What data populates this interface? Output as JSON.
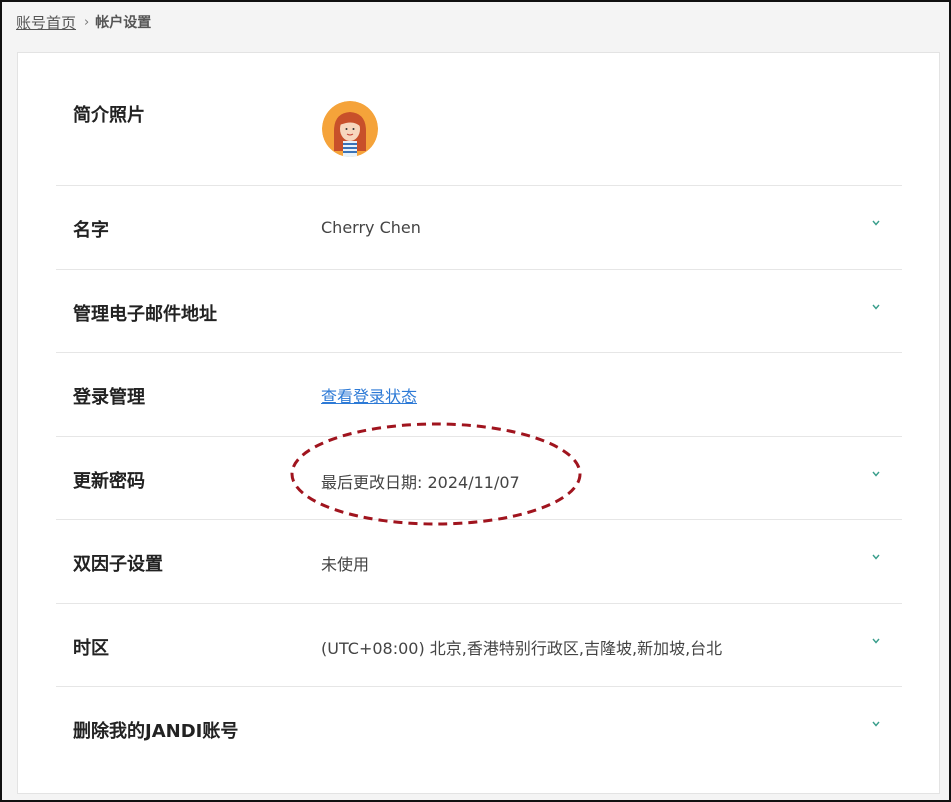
{
  "breadcrumb": {
    "home": "账号首页",
    "separator": "›",
    "current": "帐户设置"
  },
  "rows": {
    "profile_photo": {
      "label": "简介照片"
    },
    "name": {
      "label": "名字",
      "value": "Cherry Chen"
    },
    "email": {
      "label": "管理电子邮件地址"
    },
    "login": {
      "label": "登录管理",
      "link": "查看登录状态"
    },
    "password": {
      "label": "更新密码",
      "value": "最后更改日期: 2024/11/07"
    },
    "two_factor": {
      "label": "双因子设置",
      "value": "未使用"
    },
    "timezone": {
      "label": "时区",
      "value": "(UTC+08:00) 北京,香港特别行政区,吉隆坡,新加坡,台北"
    },
    "delete": {
      "label": "删除我的JANDI账号"
    }
  },
  "icons": {
    "chevron": "chevron-down-icon",
    "avatar": "avatar"
  },
  "colors": {
    "link": "#2d7ad6",
    "chevron": "#3a9e8c",
    "annotation": "#a0141e"
  }
}
